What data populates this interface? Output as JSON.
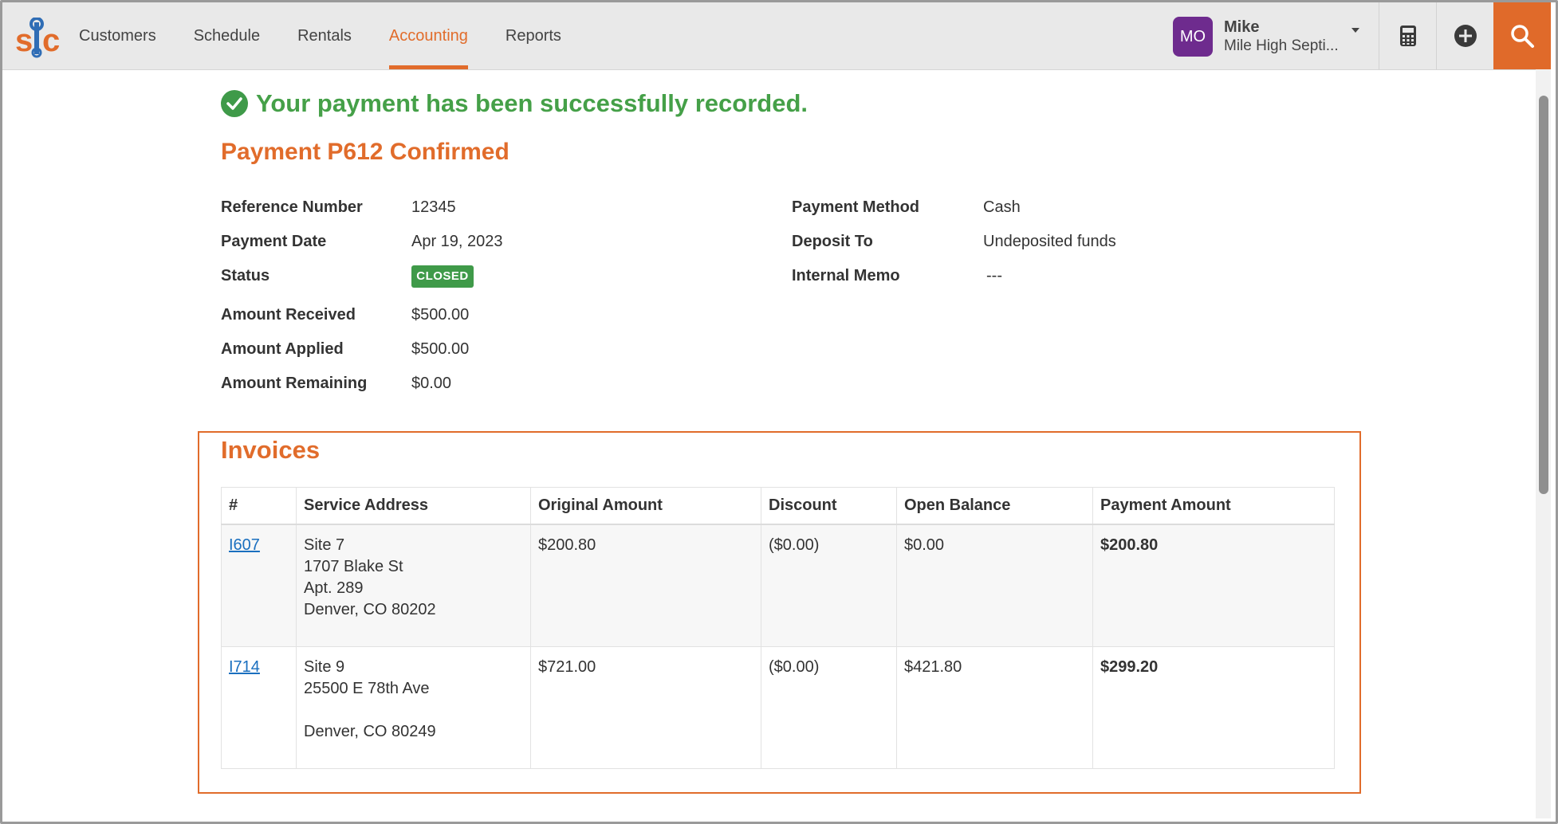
{
  "nav": {
    "items": [
      "Customers",
      "Schedule",
      "Rentals",
      "Accounting",
      "Reports"
    ],
    "active": "Accounting"
  },
  "user": {
    "initials": "MO",
    "name": "Mike",
    "company": "Mile High Septi..."
  },
  "icons": {
    "logo": "sic-logo",
    "calculator": "calculator-icon",
    "add": "plus-circle-icon",
    "search": "search-icon",
    "success": "check-circle-icon"
  },
  "colors": {
    "accent": "#e16c2b",
    "success": "#45a048",
    "avatar": "#6e2b8e",
    "link": "#1a6fbf"
  },
  "payment": {
    "success_message": "Your payment has been successfully recorded.",
    "title": "Payment P612 Confirmed",
    "labels": {
      "reference_number": "Reference Number",
      "payment_date": "Payment Date",
      "status": "Status",
      "amount_received": "Amount Received",
      "amount_applied": "Amount Applied",
      "amount_remaining": "Amount Remaining",
      "payment_method": "Payment Method",
      "deposit_to": "Deposit To",
      "internal_memo": "Internal Memo"
    },
    "values": {
      "reference_number": "12345",
      "payment_date": "Apr 19, 2023",
      "status": "CLOSED",
      "amount_received": "$500.00",
      "amount_applied": "$500.00",
      "amount_remaining": "$0.00",
      "payment_method": "Cash",
      "deposit_to": "Undeposited funds",
      "internal_memo": "---"
    }
  },
  "invoices": {
    "title": "Invoices",
    "columns": [
      "#",
      "Service Address",
      "Original Amount",
      "Discount",
      "Open Balance",
      "Payment Amount"
    ],
    "rows": [
      {
        "number": "I607",
        "address": [
          "Site 7",
          "1707 Blake St",
          "Apt. 289",
          "Denver, CO 80202"
        ],
        "original_amount": "$200.80",
        "discount": "($0.00)",
        "open_balance": "$0.00",
        "payment_amount": "$200.80"
      },
      {
        "number": "I714",
        "address": [
          "Site 9",
          "25500 E 78th Ave",
          "",
          "Denver, CO 80249"
        ],
        "original_amount": "$721.00",
        "discount": "($0.00)",
        "open_balance": "$421.80",
        "payment_amount": "$299.20"
      }
    ]
  }
}
